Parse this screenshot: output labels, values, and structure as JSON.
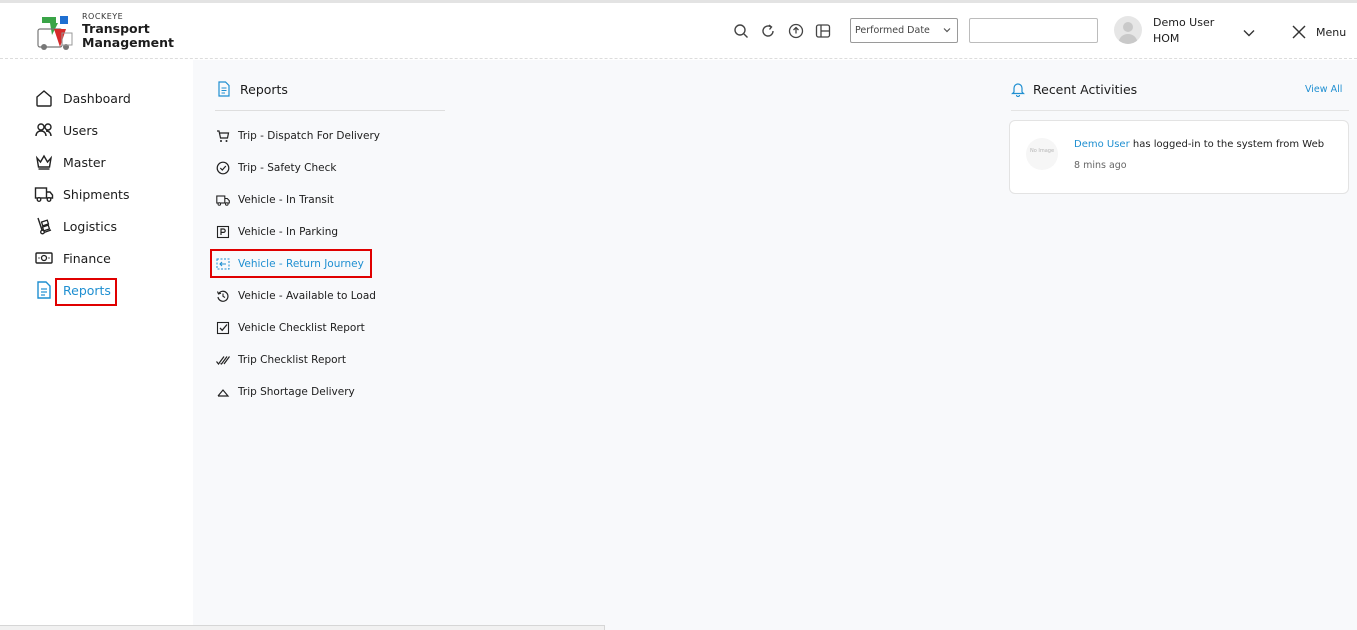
{
  "brand": {
    "small": "ROCKEYE",
    "line1": "Transport",
    "line2": "Management"
  },
  "header": {
    "date_filter": "Performed Date",
    "date_value": "",
    "user_name": "Demo User",
    "user_org": "HOM",
    "menu_label": "Menu"
  },
  "sidebar": {
    "items": [
      {
        "label": "Dashboard",
        "icon": "home-icon"
      },
      {
        "label": "Users",
        "icon": "users-icon"
      },
      {
        "label": "Master",
        "icon": "crown-icon"
      },
      {
        "label": "Shipments",
        "icon": "truck-icon"
      },
      {
        "label": "Logistics",
        "icon": "hand-truck-icon"
      },
      {
        "label": "Finance",
        "icon": "money-icon"
      },
      {
        "label": "Reports",
        "icon": "document-icon",
        "active": true
      }
    ]
  },
  "reports": {
    "title": "Reports",
    "items": [
      {
        "label": "Trip - Dispatch For Delivery",
        "icon": "cart-icon"
      },
      {
        "label": "Trip - Safety Check",
        "icon": "check-circle-icon"
      },
      {
        "label": "Vehicle - In Transit",
        "icon": "truck-icon"
      },
      {
        "label": "Vehicle - In Parking",
        "icon": "parking-icon"
      },
      {
        "label": "Vehicle - Return Journey",
        "icon": "return-journey-icon",
        "active": true
      },
      {
        "label": "Vehicle - Available to Load",
        "icon": "history-icon"
      },
      {
        "label": "Vehicle Checklist Report",
        "icon": "checkbox-icon"
      },
      {
        "label": "Trip Checklist Report",
        "icon": "double-check-icon"
      },
      {
        "label": "Trip Shortage Delivery",
        "icon": "triangle-icon"
      }
    ]
  },
  "activities": {
    "title": "Recent Activities",
    "view_all": "View All",
    "no_image": "No Image",
    "items": [
      {
        "who": "Demo User",
        "text": " has logged-in to the system from Web",
        "time": "8 mins ago"
      }
    ]
  },
  "colors": {
    "accent": "#1f8fd1",
    "highlight": "#e00000",
    "panel_bg": "#f8f9fb"
  }
}
